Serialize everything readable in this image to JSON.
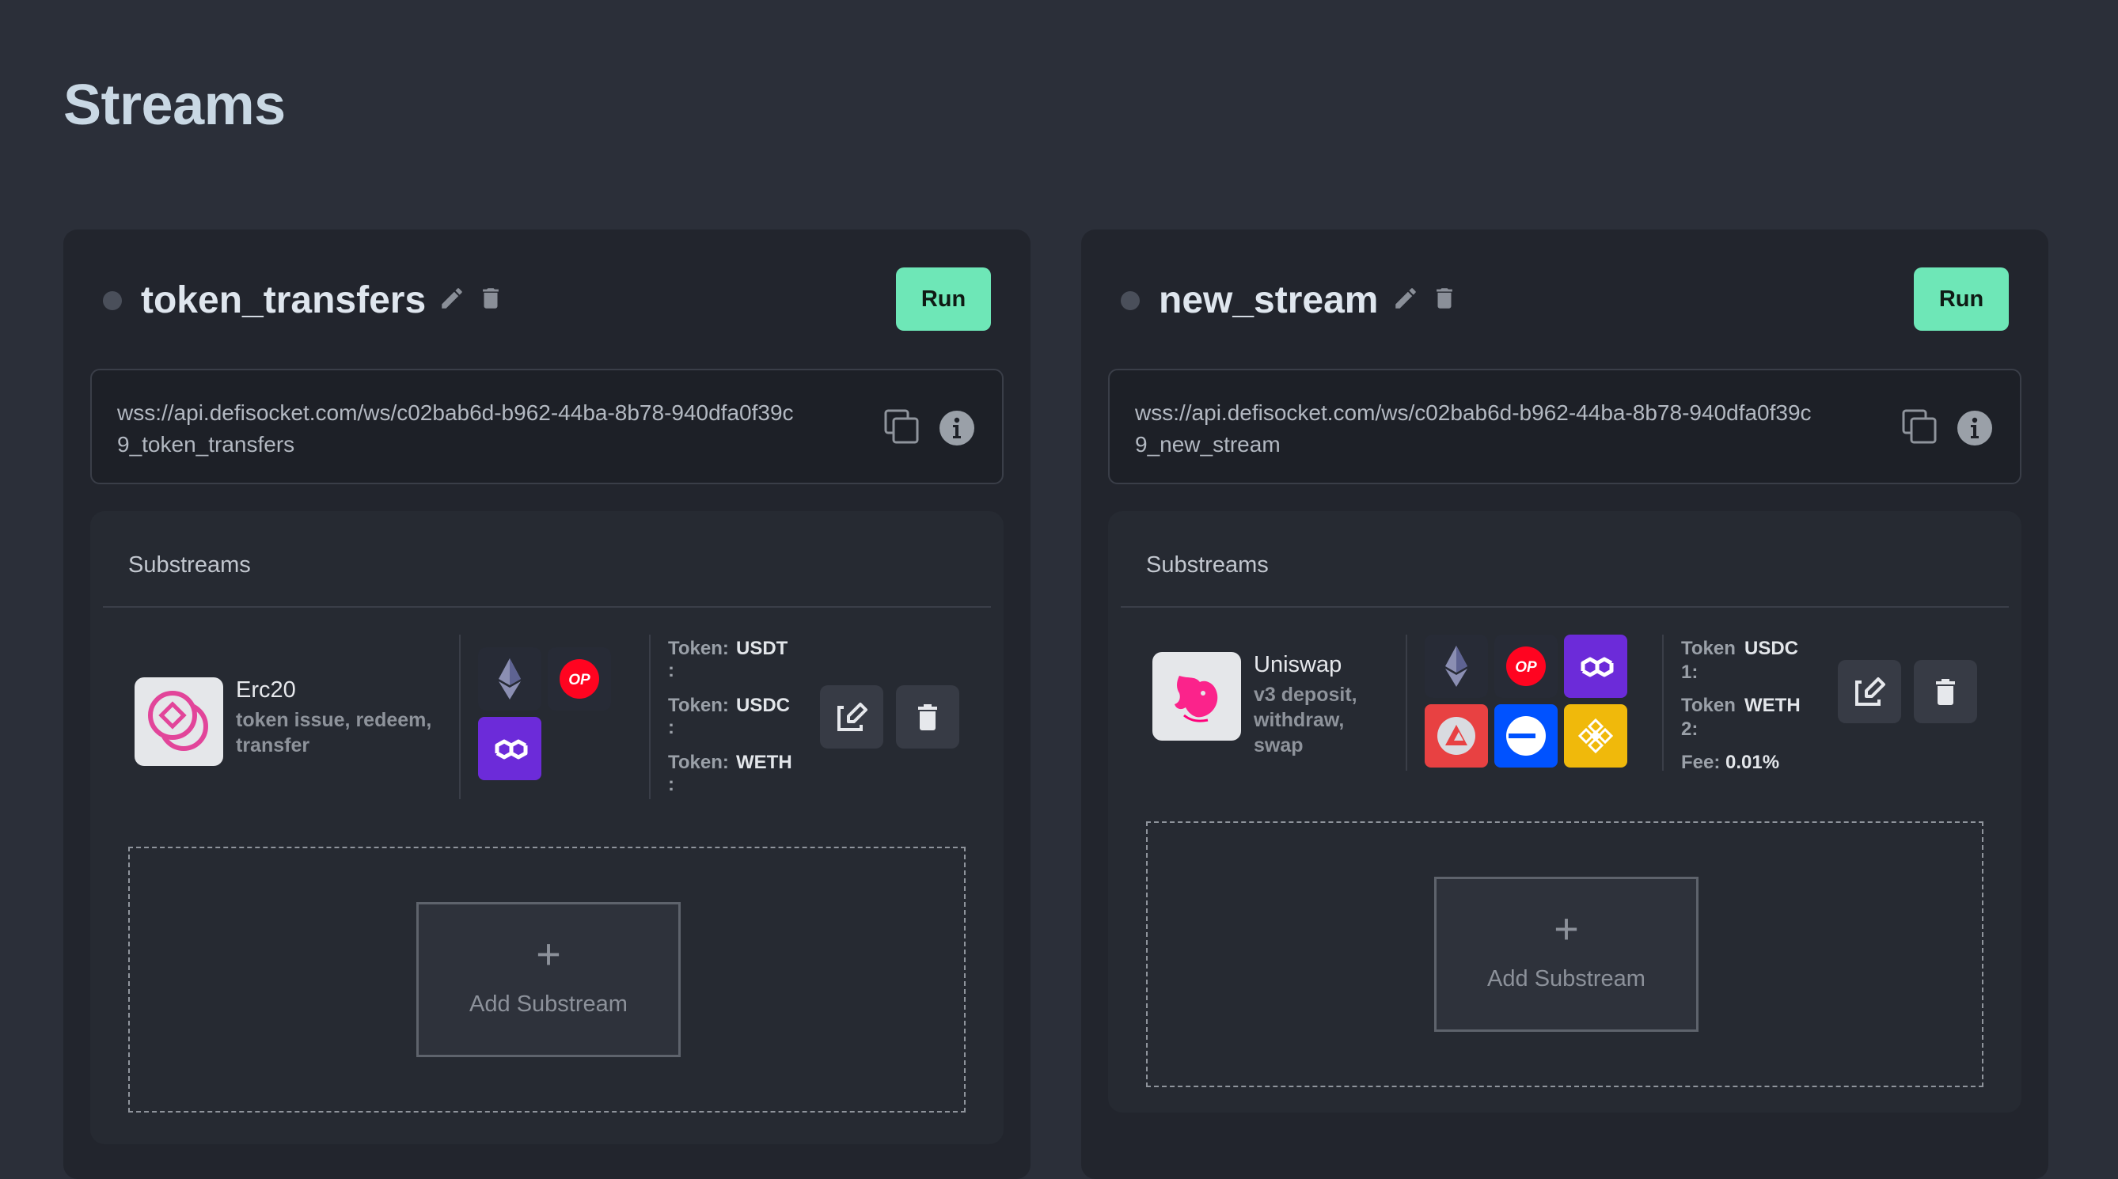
{
  "page": {
    "title": "Streams"
  },
  "colors": {
    "run": "#6ee7b7",
    "background": "#2b2f39",
    "card": "#22252d"
  },
  "streams": [
    {
      "name": "token_transfers",
      "run_label": "Run",
      "url": "wss://api.defisocket.com/ws/c02bab6d-b962-44ba-8b78-940dfa0f39c9_token_transfers",
      "substreams_title": "Substreams",
      "substream": {
        "name": "Erc20",
        "description": "token issue, redeem, transfer",
        "logo": "erc20-logo",
        "chains": [
          "ethereum-icon",
          "optimism-icon",
          "polygon-icon"
        ],
        "params": [
          {
            "label": "Token:",
            "value": "USDT",
            "suffix": ":"
          },
          {
            "label": "Token:",
            "value": "USDC",
            "suffix": ":"
          },
          {
            "label": "Token:",
            "value": "WETH",
            "suffix": ":"
          }
        ]
      },
      "add_label": "Add Substream",
      "add_plus": "+"
    },
    {
      "name": "new_stream",
      "run_label": "Run",
      "url": "wss://api.defisocket.com/ws/c02bab6d-b962-44ba-8b78-940dfa0f39c9_new_stream",
      "substreams_title": "Substreams",
      "substream": {
        "name": "Uniswap",
        "description": "v3 deposit, withdraw, swap",
        "logo": "uniswap-logo",
        "chains": [
          "ethereum-icon",
          "optimism-icon",
          "polygon-icon",
          "avalanche-icon",
          "base-icon",
          "bnb-icon"
        ],
        "params": [
          {
            "label": "Token",
            "label2": "1:",
            "value": "USDC"
          },
          {
            "label": "Token",
            "label2": "2:",
            "value": "WETH"
          },
          {
            "label": "Fee:",
            "value": "0.01%"
          }
        ]
      },
      "add_label": "Add Substream",
      "add_plus": "+"
    }
  ]
}
